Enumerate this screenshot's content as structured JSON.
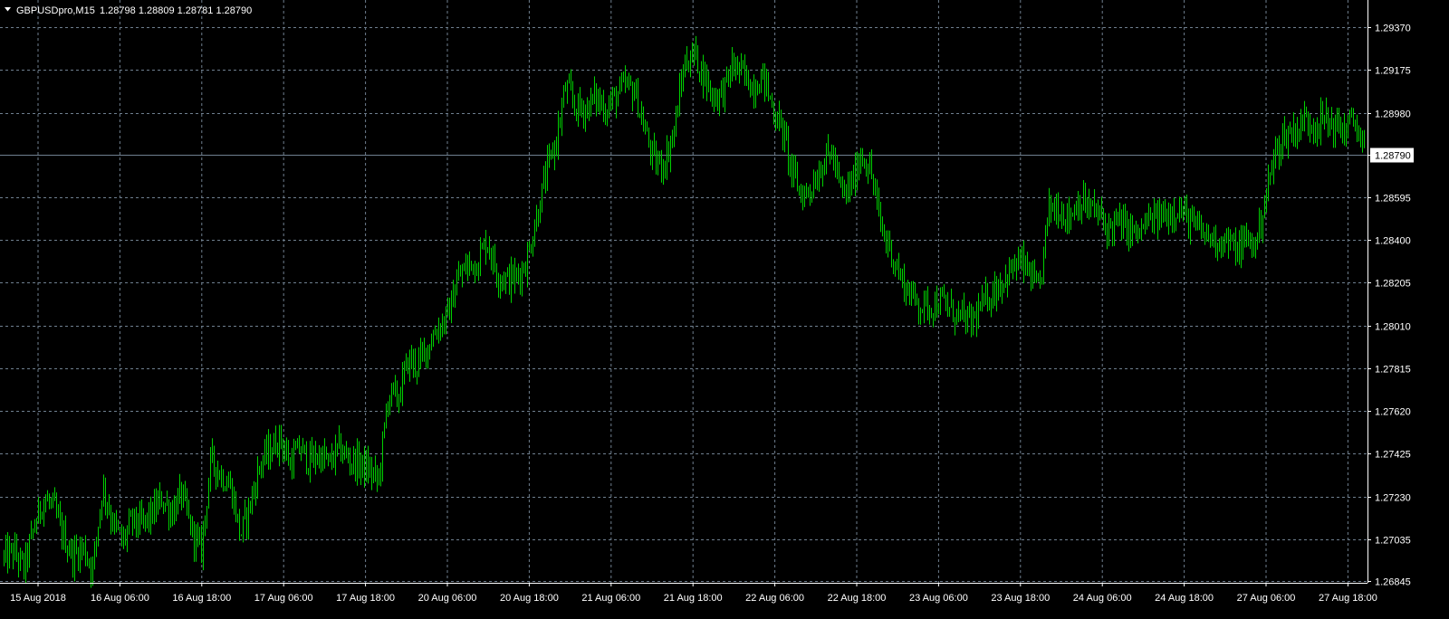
{
  "header": {
    "symbol_timeframe": "GBPUSDpro,M15",
    "ohlc": "1.28798 1.28809 1.28781 1.28790",
    "menu_icon": "triangle-down-icon"
  },
  "current_price_label": "1.28790",
  "colors": {
    "background": "#000000",
    "grid": "#6f7f8f",
    "axis": "#ffffff",
    "bars": "#00d000",
    "price_line": "#6f7f8f",
    "text": "#ffffff"
  },
  "chart_data": {
    "type": "bar",
    "title": "",
    "symbol": "GBPUSDpro",
    "timeframe": "M15",
    "grid": true,
    "xlabel": "",
    "ylabel": "",
    "ylim": [
      1.2676,
      1.2947
    ],
    "y_ticks": [
      "1.29370",
      "1.29175",
      "1.28980",
      "1.28790",
      "1.28595",
      "1.28400",
      "1.28205",
      "1.28010",
      "1.27815",
      "1.27620",
      "1.27425",
      "1.27230",
      "1.27035",
      "1.26845"
    ],
    "x_ticks": [
      "15 Aug 2018",
      "16 Aug 06:00",
      "16 Aug 18:00",
      "17 Aug 06:00",
      "17 Aug 18:00",
      "20 Aug 06:00",
      "20 Aug 18:00",
      "21 Aug 06:00",
      "21 Aug 18:00",
      "22 Aug 06:00",
      "22 Aug 18:00",
      "23 Aug 06:00",
      "23 Aug 18:00",
      "24 Aug 06:00",
      "24 Aug 18:00",
      "27 Aug 06:00",
      "27 Aug 18:00"
    ],
    "current_price": 1.2879,
    "series": [
      {
        "values": [
          1.2695,
          1.2698,
          1.269,
          1.2708,
          1.2722,
          1.2718,
          1.2705,
          1.2696,
          1.27,
          1.269,
          1.2728,
          1.2712,
          1.2702,
          1.2712,
          1.271,
          1.2715,
          1.2722,
          1.2716,
          1.2724,
          1.2708,
          1.2698,
          1.274,
          1.2733,
          1.2728,
          1.2705,
          1.272,
          1.2738,
          1.2744,
          1.275,
          1.2738,
          1.2745,
          1.2739,
          1.2742,
          1.2738,
          1.2745,
          1.274,
          1.2738,
          1.2735,
          1.273,
          1.277,
          1.2768,
          1.2785,
          1.2783,
          1.2792,
          1.28,
          1.2805,
          1.2822,
          1.2828,
          1.283,
          1.284,
          1.2825,
          1.2822,
          1.2823,
          1.283,
          1.285,
          1.287,
          1.2885,
          1.291,
          1.29,
          1.29,
          1.2905,
          1.29,
          1.2905,
          1.291,
          1.2908,
          1.289,
          1.2875,
          1.2875,
          1.289,
          1.292,
          1.2925,
          1.2915,
          1.2905,
          1.2908,
          1.292,
          1.2915,
          1.291,
          1.2915,
          1.29,
          1.289,
          1.287,
          1.286,
          1.2865,
          1.2875,
          1.288,
          1.286,
          1.2865,
          1.288,
          1.287,
          1.2845,
          1.2835,
          1.2822,
          1.2815,
          1.281,
          1.281,
          1.2812,
          1.2808,
          1.2805,
          1.2802,
          1.2808,
          1.2815,
          1.282,
          1.2825,
          1.283,
          1.2825,
          1.2815,
          1.2855,
          1.2855,
          1.285,
          1.2858,
          1.2855,
          1.2852,
          1.2845,
          1.2848,
          1.2845,
          1.2842,
          1.2848,
          1.285,
          1.2852,
          1.2855,
          1.285,
          1.2845,
          1.2842,
          1.284,
          1.284,
          1.2835,
          1.284,
          1.2838,
          1.286,
          1.288,
          1.2888,
          1.289,
          1.2895,
          1.2893,
          1.2895,
          1.2892,
          1.289,
          1.2895,
          1.2879
        ]
      }
    ]
  }
}
